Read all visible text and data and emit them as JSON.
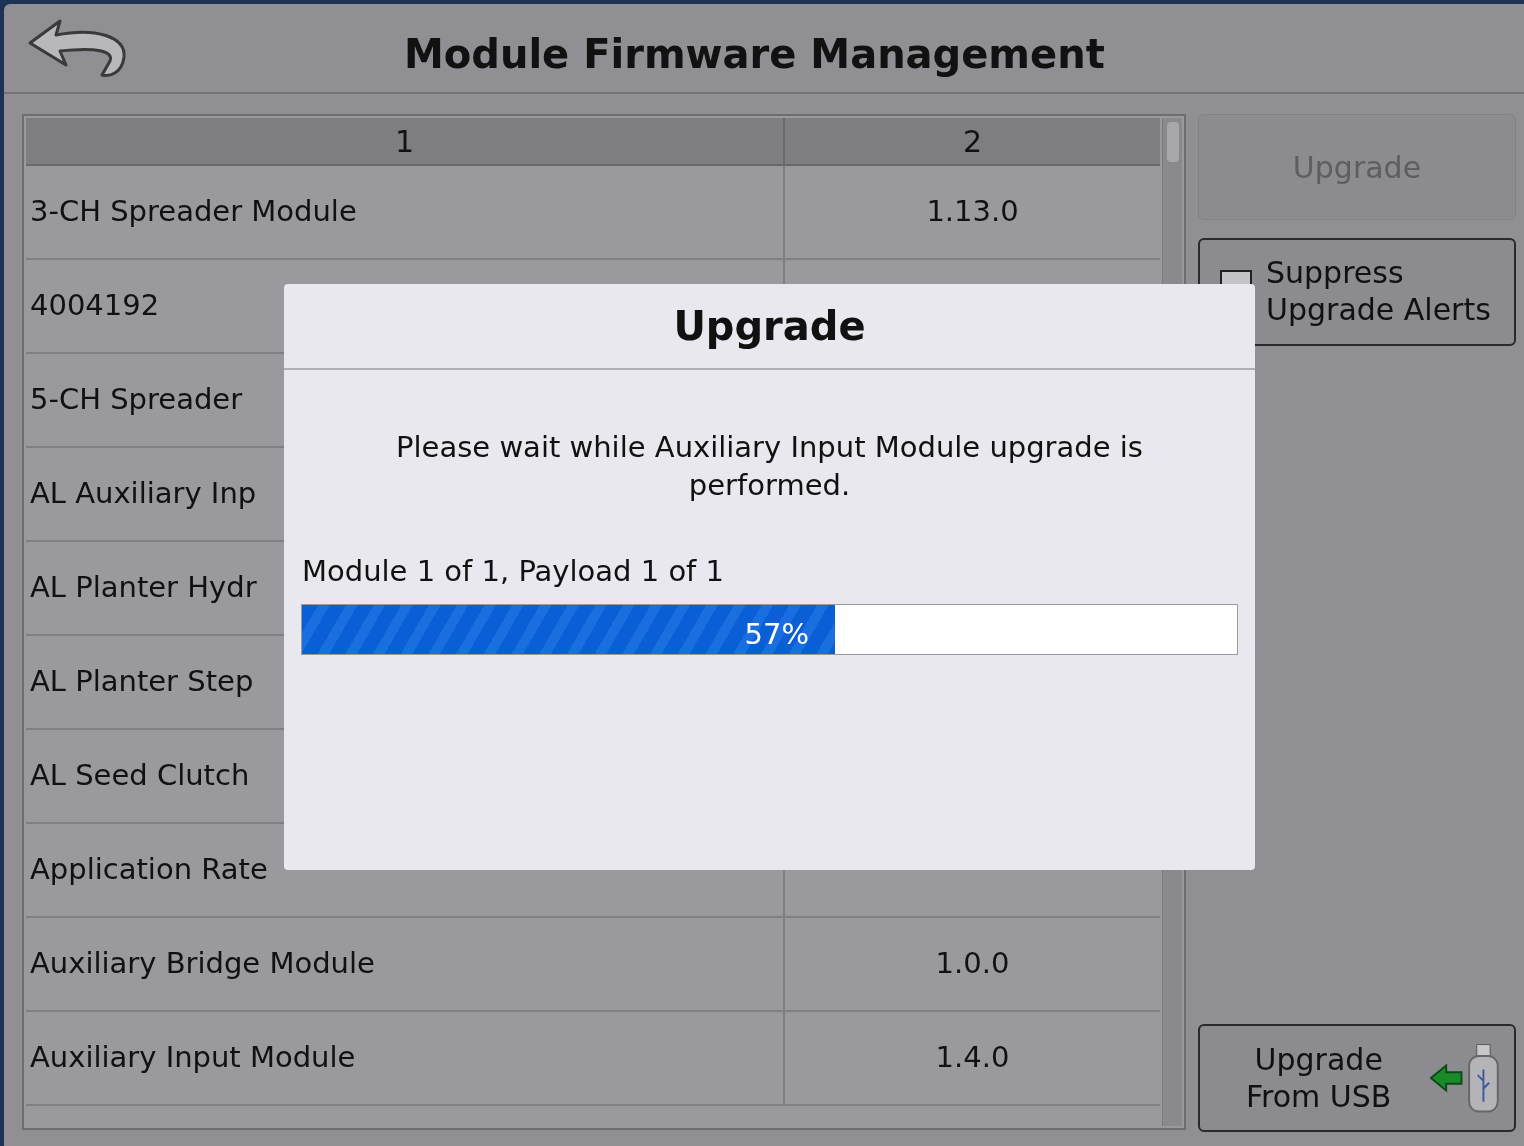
{
  "header": {
    "title": "Module Firmware Management"
  },
  "table": {
    "columns": [
      "1",
      "2"
    ],
    "rows": [
      {
        "cells": [
          "3-CH Spreader Module",
          "1.13.0"
        ]
      },
      {
        "cells": [
          "4004192"
        ]
      },
      {
        "cells": [
          "5-CH Spreader"
        ]
      },
      {
        "cells": [
          "AL Auxiliary Inp"
        ]
      },
      {
        "cells": [
          "AL Planter Hydr"
        ]
      },
      {
        "cells": [
          "AL Planter Step"
        ]
      },
      {
        "cells": [
          "AL Seed Clutch"
        ]
      },
      {
        "cells": [
          "Application Rate"
        ]
      },
      {
        "cells": [
          "Auxiliary Bridge Module",
          "1.0.0"
        ]
      },
      {
        "cells": [
          "Auxiliary Input Module",
          "1.4.0"
        ]
      }
    ]
  },
  "upgrade_button": {
    "label": "Upgrade",
    "disabled": true
  },
  "suppress_alerts": {
    "label": "Suppress Upgrade Alerts",
    "checked": false
  },
  "usb_button": {
    "label": "Upgrade From USB"
  },
  "dialog": {
    "title": "Upgrade",
    "message": "Please wait while Auxiliary Input Module upgrade is performed.",
    "progress_label": "Module 1 of 1, Payload 1 of 1",
    "level": 0.57,
    "reading": "57%"
  }
}
